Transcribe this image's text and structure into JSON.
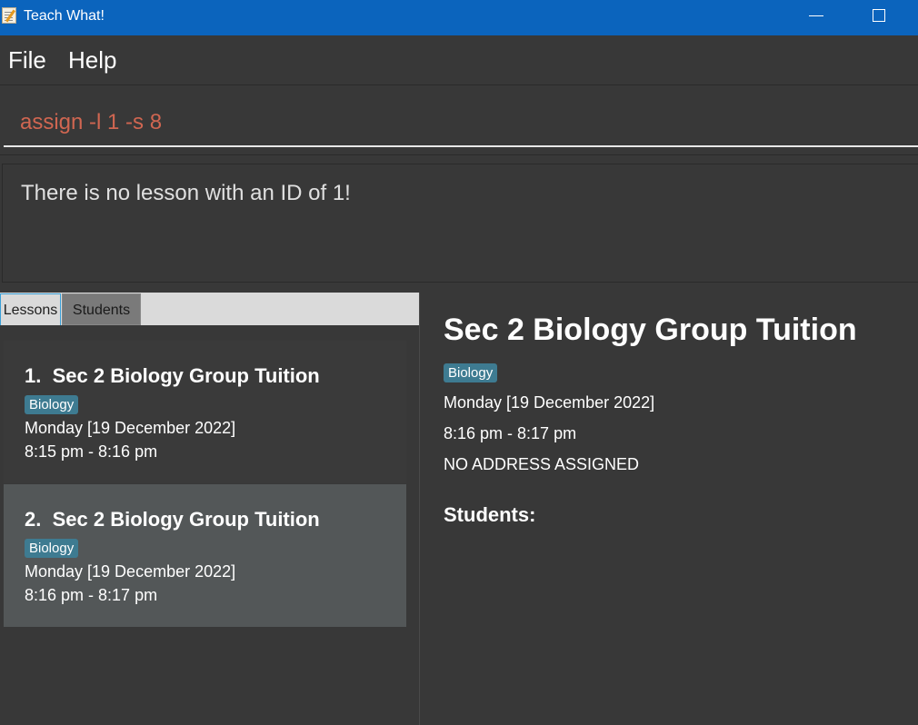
{
  "window": {
    "title": "Teach What!"
  },
  "menu": {
    "file": "File",
    "help": "Help"
  },
  "command": {
    "value": "assign -l 1 -s 8"
  },
  "result": {
    "message": "There is no lesson with an ID of 1!"
  },
  "tabs": {
    "lessons": "Lessons",
    "students": "Students"
  },
  "lessons": [
    {
      "index": "1.",
      "title": "Sec 2 Biology Group Tuition",
      "tag": "Biology",
      "day": "Monday [19 December 2022]",
      "time": "8:15 pm - 8:16 pm"
    },
    {
      "index": "2.",
      "title": "Sec 2 Biology Group Tuition",
      "tag": "Biology",
      "day": "Monday [19 December 2022]",
      "time": "8:16 pm - 8:17 pm"
    }
  ],
  "detail": {
    "title": "Sec 2 Biology Group Tuition",
    "tag": "Biology",
    "day": "Monday [19 December 2022]",
    "time": "8:16 pm - 8:17 pm",
    "address": "NO ADDRESS ASSIGNED",
    "students_label": "Students:"
  },
  "colors": {
    "titlebar": "#0b64bd",
    "tag": "#3e7b91",
    "command_text": "#d06651",
    "selected_card": "#535758"
  }
}
